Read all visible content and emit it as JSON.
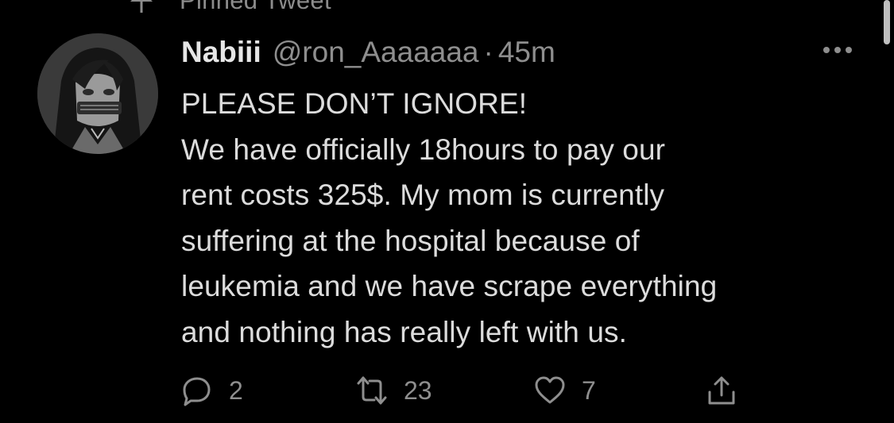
{
  "pinned": {
    "label": "Pinned Tweet"
  },
  "tweet": {
    "author": {
      "display_name": "Nabiii",
      "handle": "@ron_Aaaaaaa",
      "separator": "·",
      "time": "45m",
      "avatar_icon": "avatar-anime-portrait"
    },
    "text": "PLEASE DON’T IGNORE!\n We have officially 18hours to pay our\nrent costs 325$. My mom is currently\nsuffering at the hospital because of\nleukemia and we have scrape everything\nand nothing has really left with us.",
    "actions": {
      "reply_count": "2",
      "retweet_count": "23",
      "like_count": "7"
    }
  },
  "colors": {
    "background": "#000000",
    "primary_text": "#dcdcdc",
    "secondary_text": "#8e8e8e"
  }
}
